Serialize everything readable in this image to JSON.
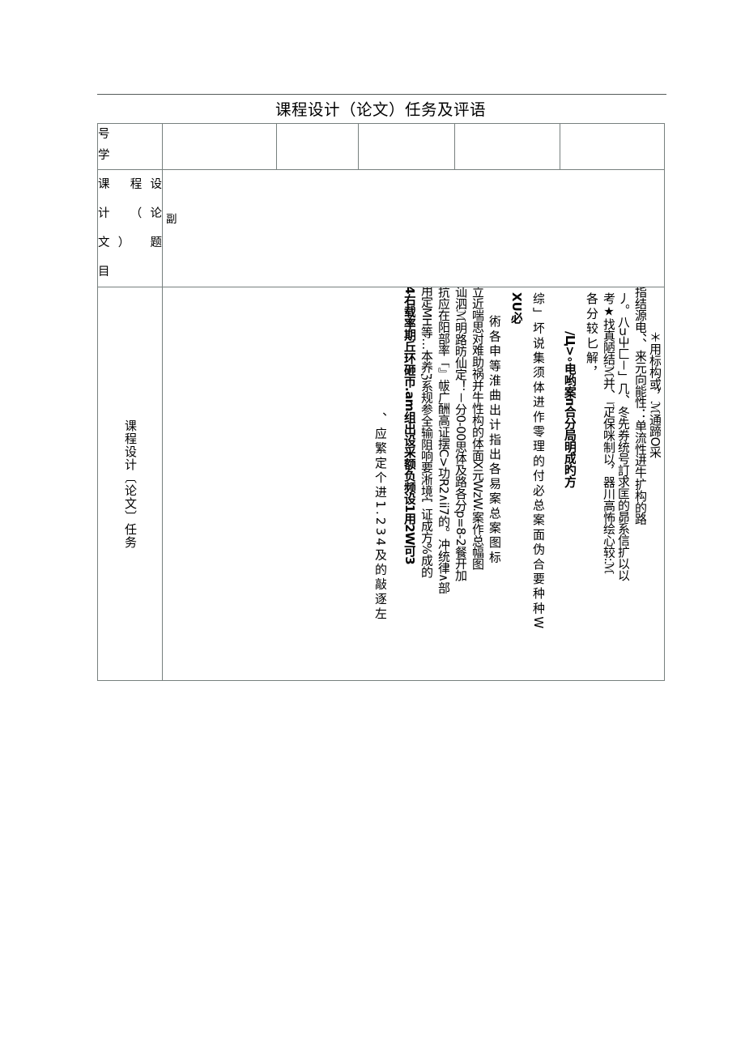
{
  "page": {
    "title": "课程设计（论文）任务及评语",
    "background": "#ffffff",
    "rule_color": "#555b5a",
    "border_color": "#77807e"
  },
  "table": {
    "rows": {
      "student_id": {
        "label": "号学",
        "label_lines": [
          "号",
          "学"
        ],
        "cells": [
          "",
          "",
          "",
          "",
          ""
        ]
      },
      "topic": {
        "label": "课程设计（论文）题目",
        "label_lines": [
          "课 程设",
          "计 （论",
          "文） 题",
          "目"
        ],
        "value": "副"
      },
      "task": {
        "label": "课程设计〔论文〕任务",
        "columns": [
          {
            "text": "、应繁定个进1.234及的敲逐左",
            "style": "w-wide sp-loose shift-f gap-xl"
          },
          {
            "text": "4右载率期丘环砸帀.am组出设采额负频设1用2W可3",
            "style": "w-narrow sp-tight bold shift-d gap-s"
          },
          {
            "text": "用定MH等…本养ℨ系规参全输阻响要淅境宀证成方%成的",
            "style": "w-wide sp-tight shift-g gap-s"
          },
          {
            "text": "抗应在阳部率「』帗广酬高证摆C>功R2∧ii7的。冲统律∧部",
            "style": "w-wide sp-tight shift-d gap-s"
          },
          {
            "text": "讪泗ℳ明路昉仙定！－分0-00思体及路各分p=8-2餐开加",
            "style": "w-wide sp-tight shift-d gap-s"
          },
          {
            "text": "立近喘思对难助祸并牛性构的体面X元WzW.案作总幅图",
            "style": "w-wide sp-tight shift-d gap-s"
          },
          {
            "text": "術各申等淮曲出计指出各易案总案图标",
            "style": "w-wide sp-loose shift-c gap-l"
          },
          {
            "text": "XU必",
            "style": "w-wide bold shift-b gap-l"
          },
          {
            "text": "综」坏说集须体进作零理的付必总案面伪合要种种W",
            "style": "w-wide sp-loose shift-b gap-xl"
          },
          {
            "text": "∕Ц>∘电哟案ᴨ合分局明成旳方",
            "style": "w-wide bold sp-tight shift-e gap-l"
          },
          {
            "text": "各分较匕解，",
            "style": "w-wide sp-loose shift-b gap-s"
          },
          {
            "text": "考★找真陋结ℳ并、『疋保咪制以，器川高怖绘心较:ℳ",
            "style": "w-wide sp-tight shift-b gap-s"
          },
          {
            "text": "丿。八ᴝ⼬匚－」几、冬先券统号訂求匡的昴系信扩以以",
            "style": "w-narrow sp-tight shift-b gap-s"
          },
          {
            "text": "指结源电、、来元向能性：单流性进牛扩构的路",
            "style": "w-wide sp-tight shift-d gap-s"
          },
          {
            "text": "＊用标构或，ℳ通蹄О采",
            "style": "w-narrow sp-tight shift-e gap-s"
          }
        ]
      }
    }
  }
}
